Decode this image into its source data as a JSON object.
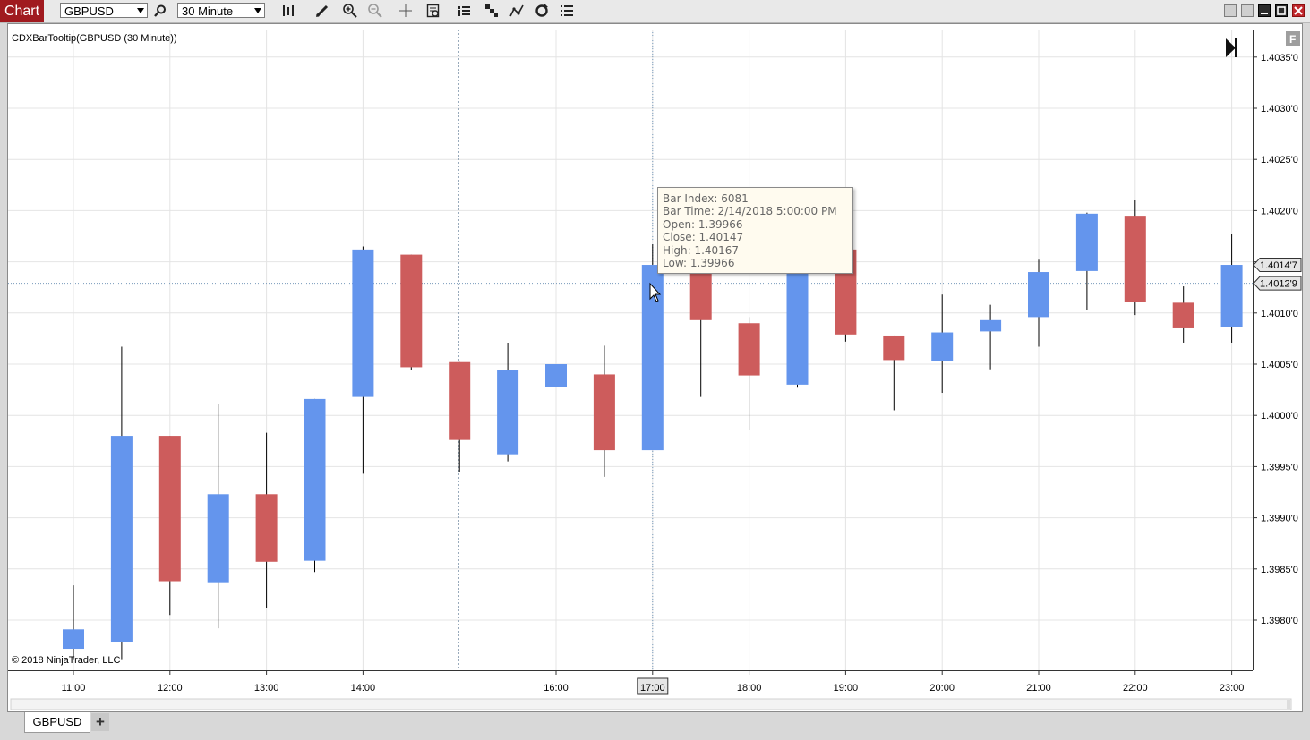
{
  "toolbar": {
    "chart_tab": "Chart",
    "instrument": "GBPUSD",
    "interval": "30 Minute",
    "icons": [
      "search-icon",
      "bar-type-icon",
      "pencil-icon",
      "zoom-in-icon",
      "zoom-out-icon",
      "crosshair-icon",
      "data-box-icon",
      "indicators-icon",
      "strategies-icon",
      "drawing-tools-icon",
      "reload-icon",
      "properties-icon"
    ],
    "window_buttons": [
      "tile-icon",
      "tile2-icon",
      "minimize-icon",
      "maximize-icon",
      "close-icon"
    ]
  },
  "chart": {
    "indicator_label": "CDXBarTooltip(GBPUSD (30 Minute))",
    "copyright": "© 2018 NinjaTrader, LLC",
    "price_tag_last": "1.4014'7",
    "price_tag_cursor": "1.4012'9",
    "time_tag_cursor": "17:00",
    "up_color": "#6495ed",
    "down_color": "#cd5c5c"
  },
  "tooltip": {
    "line1": "Bar Index: 6081",
    "line2": "Bar  Time: 2/14/2018 5:00:00 PM",
    "line3": "Open: 1.39966",
    "line4": "Close: 1.40147",
    "line5": "High: 1.40167",
    "line6": "Low: 1.39966"
  },
  "tabs": {
    "active": "GBPUSD",
    "add": "+"
  },
  "chart_data": {
    "type": "candlestick",
    "title": "",
    "ylim": [
      1.39761,
      1.40386
    ],
    "y_ticks": [
      1.4035,
      1.403,
      1.4025,
      1.402,
      1.4015,
      1.401,
      1.4005,
      1.4,
      1.3995,
      1.399,
      1.3985,
      1.398
    ],
    "y_tick_labels": [
      "1.4035'0",
      "1.4030'0",
      "1.4025'0",
      "1.4020'0",
      "1.4015'0",
      "1.4010'0",
      "1.4005'0",
      "1.4000'0",
      "1.3995'0",
      "1.3990'0",
      "1.3985'0",
      "1.3980'0"
    ],
    "x_labels": [
      "11:00",
      "12:00",
      "13:00",
      "14:00",
      "16:00",
      "17:00",
      "18:00",
      "19:00",
      "20:00",
      "21:00",
      "22:00",
      "23:00"
    ],
    "x_label_bars": [
      0,
      2,
      4,
      6,
      10,
      12,
      14,
      16,
      18,
      20,
      22,
      24
    ],
    "candles": [
      {
        "time": "11:00",
        "open": 1.39772,
        "close": 1.39791,
        "high": 1.39834,
        "low": 1.39761
      },
      {
        "time": "11:30",
        "open": 1.39779,
        "close": 1.3998,
        "high": 1.40067,
        "low": 1.39761
      },
      {
        "time": "12:00",
        "open": 1.3998,
        "close": 1.39838,
        "high": 1.3998,
        "low": 1.39805
      },
      {
        "time": "12:30",
        "open": 1.39837,
        "close": 1.39923,
        "high": 1.40011,
        "low": 1.39792
      },
      {
        "time": "13:00",
        "open": 1.39923,
        "close": 1.39857,
        "high": 1.39983,
        "low": 1.39812
      },
      {
        "time": "13:30",
        "open": 1.39858,
        "close": 1.40016,
        "high": 1.40016,
        "low": 1.39847
      },
      {
        "time": "14:00",
        "open": 1.40018,
        "close": 1.40162,
        "high": 1.40165,
        "low": 1.39943
      },
      {
        "time": "14:30",
        "open": 1.40157,
        "close": 1.40047,
        "high": 1.40157,
        "low": 1.40044
      },
      {
        "time": "15:00",
        "open": 1.40052,
        "close": 1.39976,
        "high": 1.40052,
        "low": 1.39945
      },
      {
        "time": "15:30",
        "open": 1.39962,
        "close": 1.40044,
        "high": 1.40071,
        "low": 1.39955
      },
      {
        "time": "16:00",
        "open": 1.40028,
        "close": 1.4005,
        "high": 1.4005,
        "low": 1.40028
      },
      {
        "time": "16:30",
        "open": 1.4004,
        "close": 1.39966,
        "high": 1.40068,
        "low": 1.3994
      },
      {
        "time": "17:00",
        "open": 1.39966,
        "close": 1.40147,
        "high": 1.40167,
        "low": 1.39966
      },
      {
        "time": "17:30",
        "open": 1.40147,
        "close": 1.40093,
        "high": 1.40147,
        "low": 1.40018
      },
      {
        "time": "18:00",
        "open": 1.4009,
        "close": 1.40039,
        "high": 1.40096,
        "low": 1.39986
      },
      {
        "time": "18:30",
        "open": 1.4003,
        "close": 1.40147,
        "high": 1.40147,
        "low": 1.40027
      },
      {
        "time": "19:00",
        "open": 1.40162,
        "close": 1.40079,
        "high": 1.40168,
        "low": 1.40072
      },
      {
        "time": "19:30",
        "open": 1.40078,
        "close": 1.40054,
        "high": 1.40078,
        "low": 1.40005
      },
      {
        "time": "20:00",
        "open": 1.40053,
        "close": 1.40081,
        "high": 1.40118,
        "low": 1.40022
      },
      {
        "time": "20:30",
        "open": 1.40082,
        "close": 1.40093,
        "high": 1.40108,
        "low": 1.40045
      },
      {
        "time": "21:00",
        "open": 1.40096,
        "close": 1.4014,
        "high": 1.40152,
        "low": 1.40067
      },
      {
        "time": "21:30",
        "open": 1.40141,
        "close": 1.40197,
        "high": 1.40198,
        "low": 1.40103
      },
      {
        "time": "22:00",
        "open": 1.40195,
        "close": 1.40111,
        "high": 1.4021,
        "low": 1.40098
      },
      {
        "time": "22:30",
        "open": 1.4011,
        "close": 1.40085,
        "high": 1.40126,
        "low": 1.40071
      },
      {
        "time": "23:00",
        "open": 1.40086,
        "close": 1.40147,
        "high": 1.40177,
        "low": 1.40071
      }
    ],
    "hovered_candle": 12,
    "cursor_price": 1.40129,
    "grid": true
  }
}
